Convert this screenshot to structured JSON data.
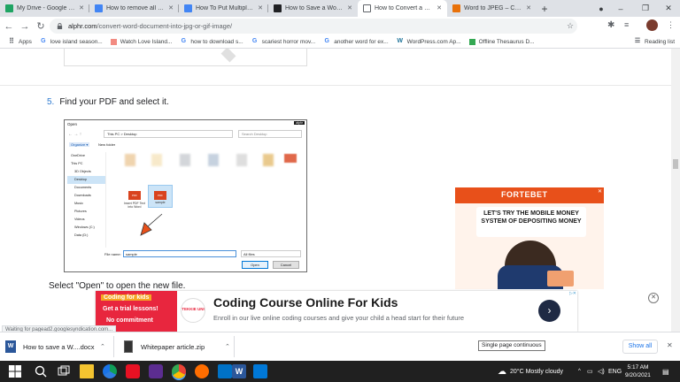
{
  "browser": {
    "tabs": [
      {
        "title": "My Drive - Google Dri",
        "color": "#1fa463"
      },
      {
        "title": "How to remove all hyp",
        "color": "#4285f4"
      },
      {
        "title": "How To Put Multiple L",
        "color": "#4285f4"
      },
      {
        "title": "How to Save a Word D",
        "color": "#202124"
      },
      {
        "title": "How to Convert a Wor",
        "color": "#5f6368",
        "active": true
      },
      {
        "title": "Word to JPEG – Conve",
        "color": "#e8710a"
      }
    ],
    "new_tab": "+",
    "address": {
      "domain": "alphr.com",
      "path": "/convert-word-document-into-jpg-or-gif-image/"
    },
    "reading_list": "Reading list",
    "bookmarks": [
      {
        "label": "Apps",
        "icon": "apps-grid-icon"
      },
      {
        "label": "love island season...",
        "icon": "google-icon"
      },
      {
        "label": "Watch Love Island...",
        "icon": "bookmark-icon"
      },
      {
        "label": "how to download s...",
        "icon": "google-icon"
      },
      {
        "label": "scariest horror mov...",
        "icon": "google-icon"
      },
      {
        "label": "another word for ex...",
        "icon": "google-icon"
      },
      {
        "label": "WordPress.com Ap...",
        "icon": "wordpress-icon"
      },
      {
        "label": "Offline Thesaurus D...",
        "icon": "bookmark-icon"
      }
    ]
  },
  "article": {
    "step5_num": "5.",
    "step5_text": "Find your PDF and select it.",
    "step6_text": "Select \"Open\" to open the new file."
  },
  "dialog": {
    "title": "Open",
    "path": "This PC > Desktop",
    "search_placeholder": "Search Desktop",
    "organize": "Organize ▾",
    "new_folder": "New folder",
    "watermark": "alphr",
    "sidebar": [
      "OneDrive",
      "This PC",
      "3D Objects",
      "Desktop",
      "Documents",
      "Downloads",
      "Music",
      "Pictures",
      "Videos",
      "Windows (C:)",
      "Data (D:)"
    ],
    "files": [
      {
        "name": "Insert PDF Text into Word",
        "type": "pdf"
      },
      {
        "name": "sample",
        "type": "pdf",
        "selected": true
      }
    ],
    "file_name_label": "File name:",
    "file_name_value": "sample",
    "filter": "All files",
    "open_button": "Open",
    "cancel_button": "Cancel"
  },
  "ad_right": {
    "brand": "FORTEBET",
    "headline": "LET'S TRY THE MOBILE MONEY SYSTEM OF DEPOSITING MONEY"
  },
  "banner_ad": {
    "left_line1": "Coding for kids",
    "left_line2": "Get a trial lessons!",
    "left_line3": "No commitment",
    "logo": "TEKKIE UNI",
    "title": "Coding Course Online For Kids",
    "subtitle": "Enroll in our live online coding courses and give your child a head start for their future"
  },
  "status_text": "Waiting for pagead2.googlesyndication.com...",
  "tooltip": "Single page continuous",
  "downloads": [
    {
      "name": "How to save a W....docx",
      "icon": "word-doc-icon"
    },
    {
      "name": "Whitepaper article.zip",
      "icon": "zip-icon"
    }
  ],
  "show_all": "Show all",
  "taskbar": {
    "weather_temp": "20°C",
    "weather_desc": "Mostly cloudy",
    "language": "ENG",
    "time": "5:17 AM",
    "date": "9/20/2021"
  }
}
